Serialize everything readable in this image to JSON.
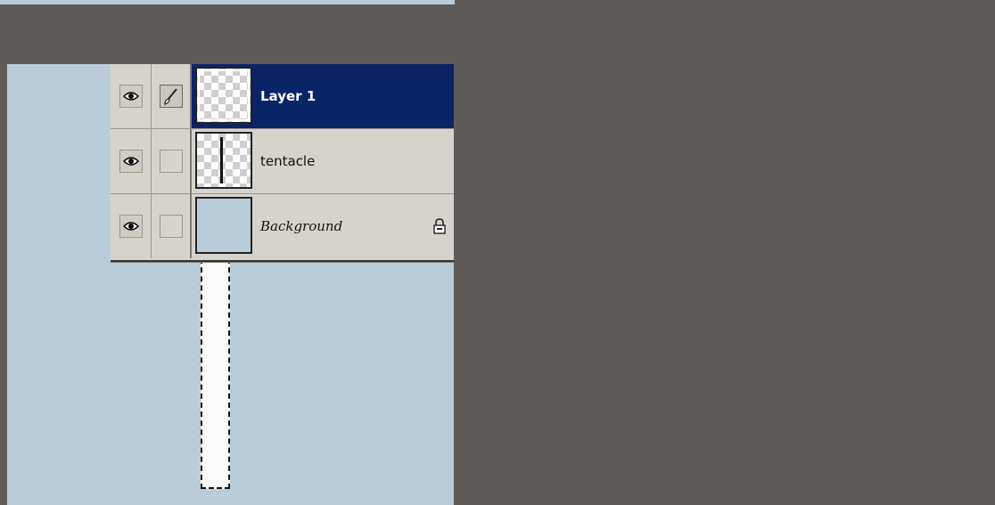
{
  "layers": [
    {
      "name": "Layer 1",
      "visible": true,
      "link": "brush-icon",
      "active": true,
      "thumbnail": "transparent"
    },
    {
      "name": "tentacle",
      "visible": true,
      "link": "none",
      "active": false,
      "thumbnail": "transparent-with-bar"
    },
    {
      "name": "Background",
      "visible": true,
      "link": "none",
      "active": false,
      "thumbnail": "solid",
      "locked": true
    }
  ],
  "colors": {
    "workspace": "#5f5b58",
    "canvas": "#b8ccd9",
    "panel": "#d6d3cc",
    "active_row": "#0b2466",
    "selection_fill": "#fbfbfb"
  }
}
